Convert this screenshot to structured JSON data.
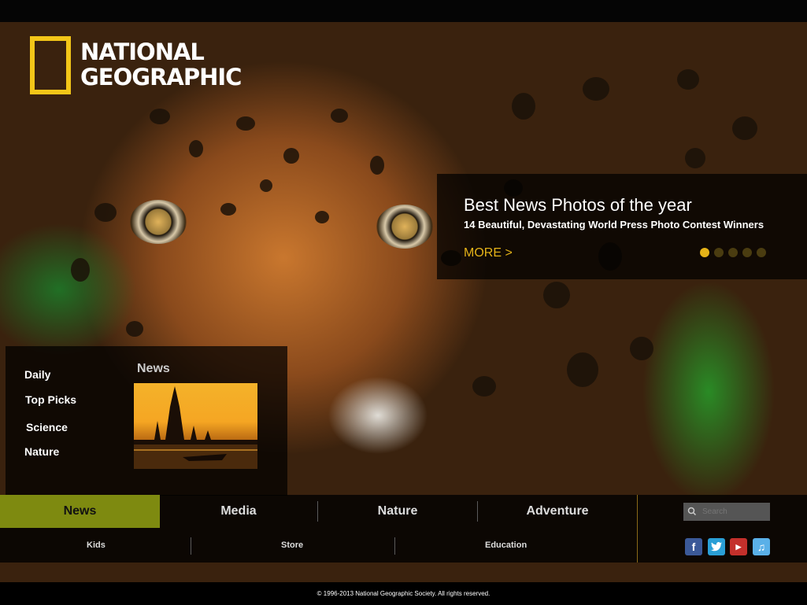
{
  "brand": {
    "logo_text_line1": "NATIONAL",
    "logo_text_line2": "GEOGRAPHIC",
    "accent": "#f3c618"
  },
  "feature": {
    "title": "Best News Photos of the year",
    "subtitle": "14 Beautiful, Devastating World Press Photo Contest Winners",
    "more_label": "MORE >",
    "slides": 5,
    "active_slide": 1
  },
  "subpanel": {
    "categories": [
      "Daily",
      "Top Picks",
      "Science",
      "Nature"
    ],
    "heading": "News"
  },
  "nav": {
    "items": [
      "News",
      "Media",
      "Nature",
      "Adventure"
    ],
    "active": "News",
    "active_color": "#7e8a10",
    "search_placeholder": "Search"
  },
  "subnav": {
    "items": [
      "Kids",
      "Store",
      "Education"
    ],
    "social": [
      "facebook-icon",
      "twitter-icon",
      "youtube-icon",
      "itunes-icon"
    ]
  },
  "footer": {
    "copyright": "© 1996-2013 National Geographic Society. All rights reserved."
  }
}
